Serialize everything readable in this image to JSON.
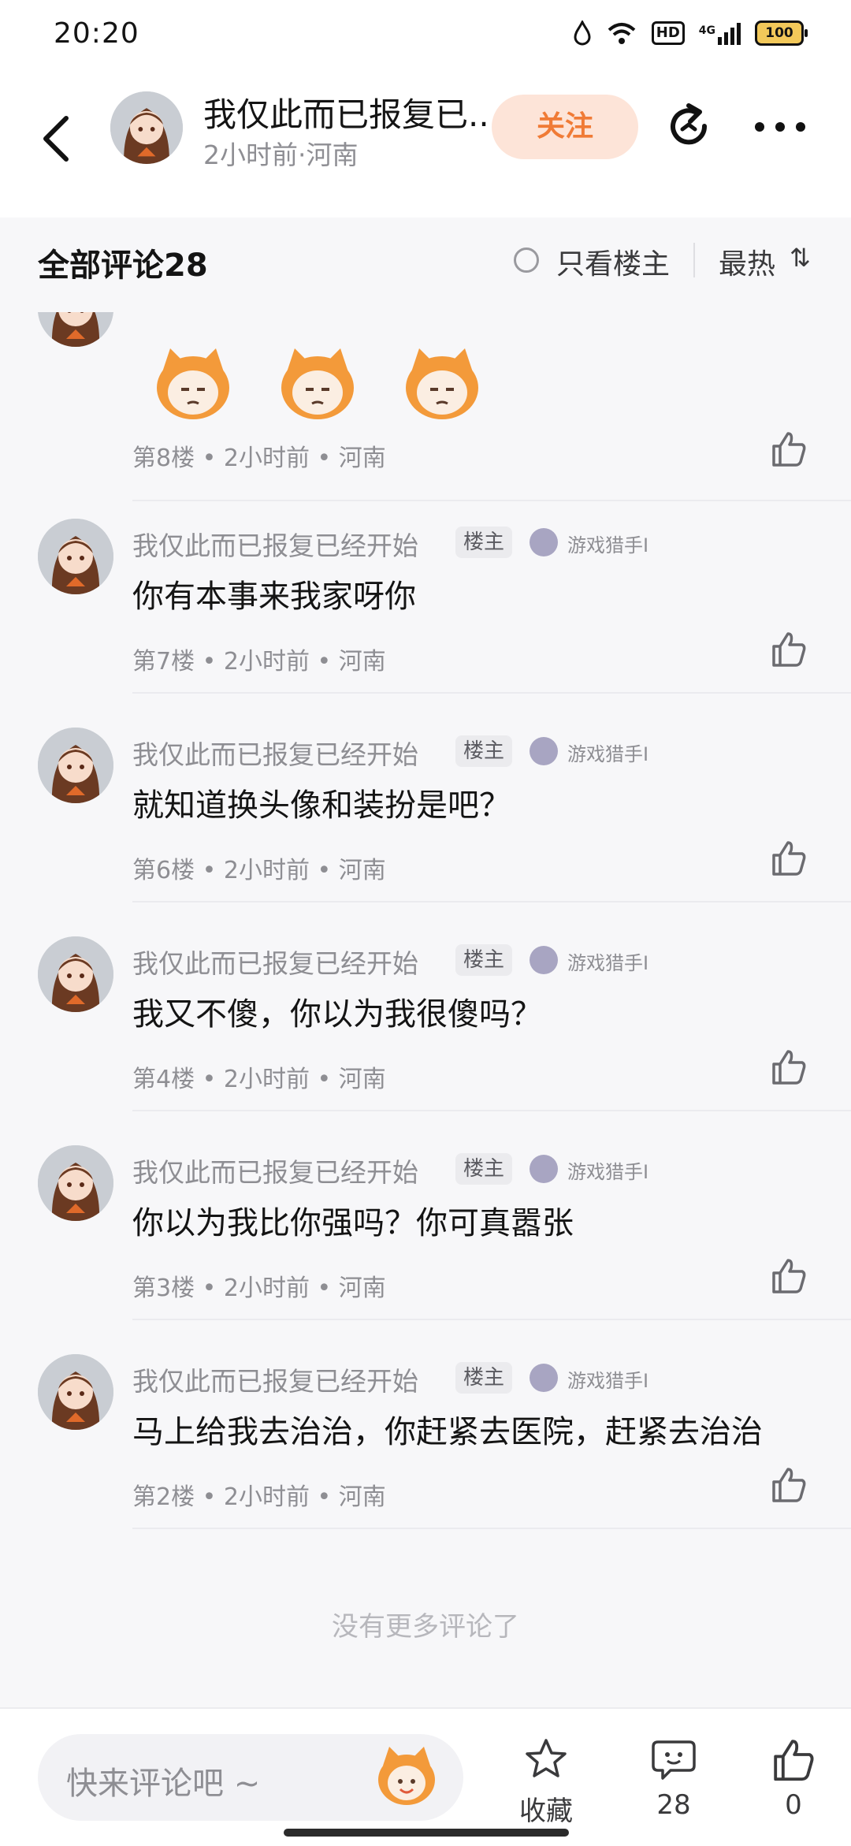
{
  "status": {
    "time": "20:20",
    "hd": "HD",
    "network": "4G",
    "battery": "100"
  },
  "header": {
    "author": "我仅此而已报复已...",
    "meta": "2小时前·河南",
    "follow_label": "关注"
  },
  "comments_bar": {
    "title": "全部评论28",
    "only_owner": "只看楼主",
    "sort": "最热",
    "sort_icon": "⇅"
  },
  "comments": [
    {
      "floor_info": "第8楼 • 2小时前 • 河南"
    },
    {
      "name": "我仅此而已报复已经开始",
      "tag": "楼主",
      "badge": "游戏猎手I",
      "text": "你有本事来我家呀你",
      "floor_info": "第7楼 • 2小时前 • 河南"
    },
    {
      "name": "我仅此而已报复已经开始",
      "tag": "楼主",
      "badge": "游戏猎手I",
      "text": "就知道换头像和装扮是吧？",
      "floor_info": "第6楼 • 2小时前 • 河南"
    },
    {
      "name": "我仅此而已报复已经开始",
      "tag": "楼主",
      "badge": "游戏猎手I",
      "text": "我又不傻，你以为我很傻吗？",
      "floor_info": "第4楼 • 2小时前 • 河南"
    },
    {
      "name": "我仅此而已报复已经开始",
      "tag": "楼主",
      "badge": "游戏猎手I",
      "text": "你以为我比你强吗？你可真嚣张",
      "floor_info": "第3楼 • 2小时前 • 河南"
    },
    {
      "name": "我仅此而已报复已经开始",
      "tag": "楼主",
      "badge": "游戏猎手I",
      "text": "马上给我去治治，你赶紧去医院，赶紧去治治",
      "floor_info": "第2楼 • 2小时前 • 河南"
    }
  ],
  "no_more": "没有更多评论了",
  "bottom": {
    "placeholder": "快来评论吧 ~",
    "favorite": "收藏",
    "comments_count": "28",
    "likes_count": "0"
  },
  "colors": {
    "accent": "#f07b36",
    "follow_bg": "#fde4d8"
  }
}
